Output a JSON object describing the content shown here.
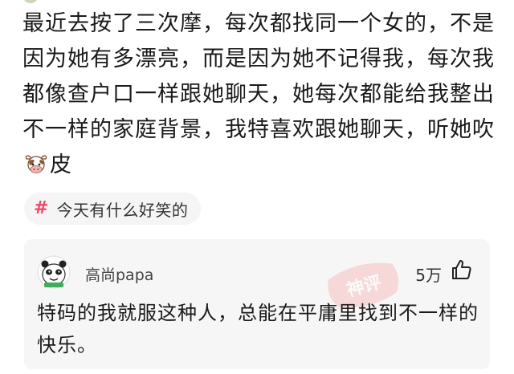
{
  "post": {
    "text_before_emoji": "最近去按了三次摩，每次都找同一个女的，不是因为她有多漂亮，而是因为她不记得我，每次我都像查户口一样跟她聊天，她每次都能给我整出不一样的家庭背景，我特喜欢跟她聊天，听她吹",
    "emoji": "cow-face-emoji",
    "text_after_emoji": "皮"
  },
  "topic": {
    "icon": "hash-icon",
    "label": "今天有什么好笑的"
  },
  "comment": {
    "author": "高尚papa",
    "likes": "5万",
    "like_icon": "thumbs-up-icon",
    "stamp_text": "神评",
    "text": "特码的我就服这种人，总能在平庸里找到不一样的快乐。"
  },
  "colors": {
    "accent": "#ee4a6d",
    "card_bg": "#f6f6f6",
    "tag_bg": "#f5f5f5",
    "text": "#1a1a1a"
  }
}
